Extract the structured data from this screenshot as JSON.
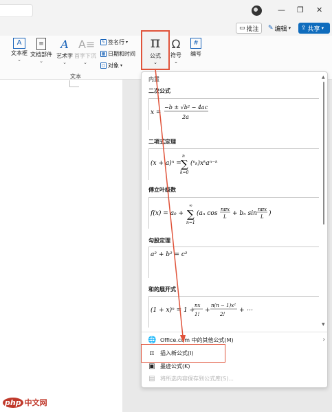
{
  "cmdbar": {
    "comment": "批注",
    "edit": "编辑",
    "share": "共享"
  },
  "ribbon": {
    "group_label": "文本",
    "buttons": {
      "textbox": "文本框",
      "quickparts": "文档部件",
      "wordart": "艺术字",
      "dropcap": "首字下沉",
      "signature": "签名行",
      "datetime": "日期和时间",
      "object": "对象",
      "formula": "公式",
      "symbol": "符号",
      "number": "编号"
    }
  },
  "gallery": {
    "header": "内置",
    "sections": [
      {
        "title": "二次公式"
      },
      {
        "title": "二项式定理"
      },
      {
        "title": "傅立叶级数"
      },
      {
        "title": "勾股定理"
      },
      {
        "title": "和的展开式"
      }
    ],
    "menu": {
      "office_more": "Office.com 中的其他公式(M)",
      "insert_new": "插入新公式(I)",
      "ink": "墨迹公式(K)",
      "save_selection": "将所选内容保存到公式库(S)..."
    }
  },
  "watermark": {
    "logo": "php",
    "text": "中文网"
  }
}
